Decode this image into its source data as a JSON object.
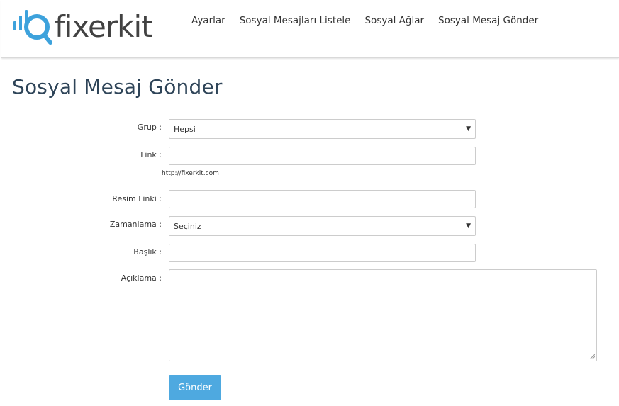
{
  "header": {
    "logo_text": "fixerkit",
    "nav": [
      "Ayarlar",
      "Sosyal Mesajları Listele",
      "Sosyal Ağlar",
      "Sosyal Mesaj Gönder"
    ]
  },
  "page": {
    "title": "Sosyal Mesaj Gönder"
  },
  "form": {
    "grup": {
      "label": "Grup :",
      "value": "Hepsi"
    },
    "link": {
      "label": "Link :",
      "value": "",
      "help": "http://fixerkit.com"
    },
    "resim_linki": {
      "label": "Resim Linki :",
      "value": ""
    },
    "zamanlama": {
      "label": "Zamanlama :",
      "value": "Seçiniz"
    },
    "baslik": {
      "label": "Başlık :",
      "value": ""
    },
    "aciklama": {
      "label": "Açıklama :",
      "value": ""
    },
    "submit_label": "Gönder"
  },
  "colors": {
    "accent": "#4ea9e0",
    "logo_icon": "#3da2dc",
    "title": "#2e4458"
  }
}
